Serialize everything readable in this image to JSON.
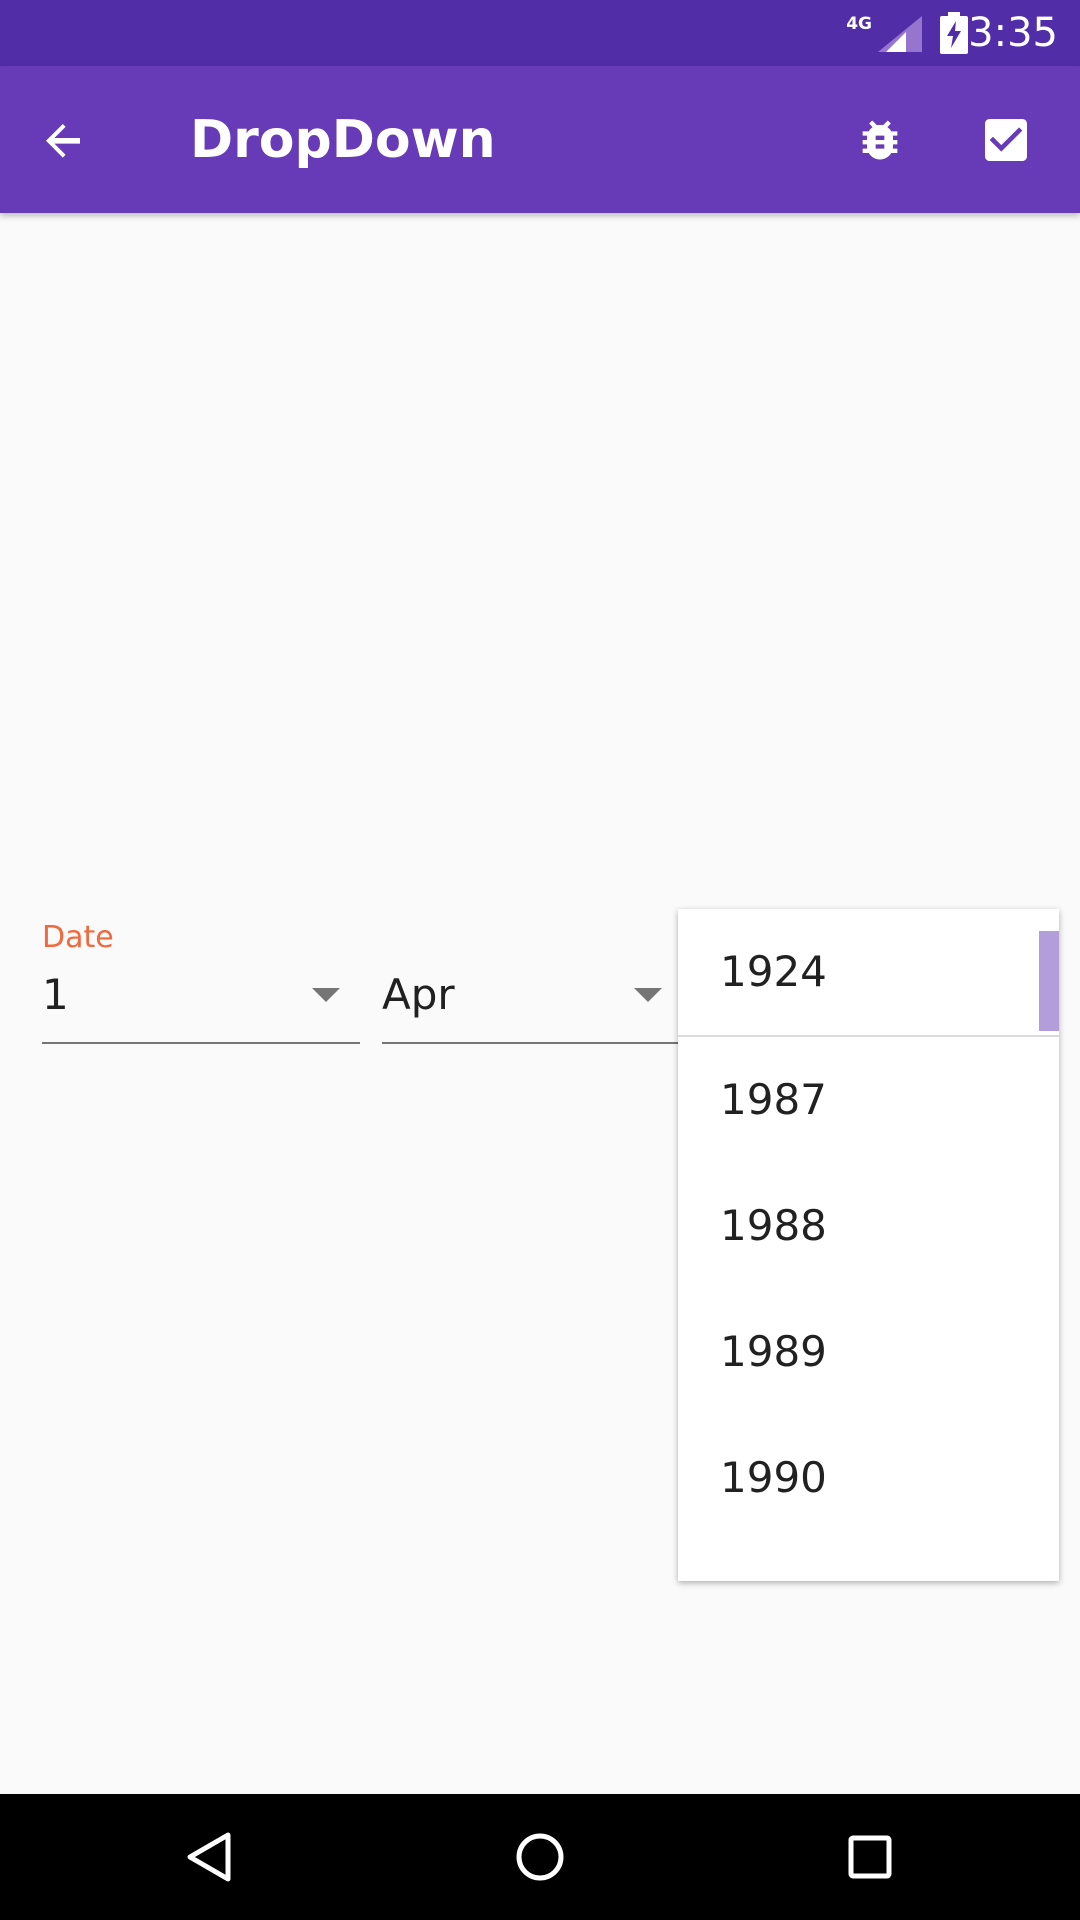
{
  "status_bar": {
    "network": "4G",
    "time": "3:35"
  },
  "app_bar": {
    "title": "DropDown",
    "back_icon": "arrow-back-icon",
    "actions": [
      "bug-icon",
      "check-box-icon"
    ]
  },
  "form": {
    "label": "Date",
    "day": {
      "value": "1"
    },
    "month": {
      "value": "Apr"
    }
  },
  "year_dropdown": {
    "selected": "1924",
    "options": [
      "1987",
      "1988",
      "1989",
      "1990"
    ]
  },
  "nav_bar": {
    "buttons": [
      "back-triangle-icon",
      "home-circle-icon",
      "recents-square-icon"
    ]
  },
  "colors": {
    "primary": "#673ab7",
    "primary_dark": "#512da8",
    "accent": "#ef6a3f",
    "scroll_thumb": "#b39ddb"
  }
}
